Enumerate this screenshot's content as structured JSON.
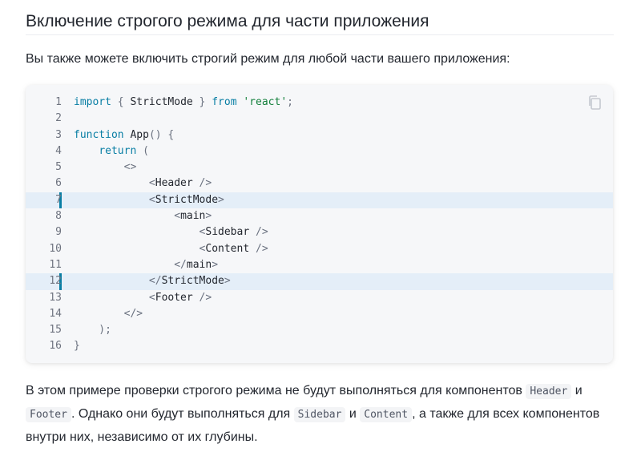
{
  "heading": "Включение строгого режима для части приложения",
  "intro": "Вы также можете включить строгий режим для любой части вашего приложения:",
  "code": {
    "copy_icon": "copy-icon",
    "highlight_color": "#e4eef8",
    "accent_color": "#087ea4",
    "lines": [
      {
        "n": "1",
        "tokens": [
          [
            "kw",
            "import"
          ],
          [
            "pn",
            " { "
          ],
          [
            "pl",
            "StrictMode"
          ],
          [
            "pn",
            " } "
          ],
          [
            "kw",
            "from"
          ],
          [
            "pn",
            " "
          ],
          [
            "str",
            "'react'"
          ],
          [
            "pn",
            ";"
          ]
        ]
      },
      {
        "n": "2",
        "tokens": []
      },
      {
        "n": "3",
        "tokens": [
          [
            "kw",
            "function"
          ],
          [
            "pn",
            " "
          ],
          [
            "pl",
            "App"
          ],
          [
            "pn",
            "() {"
          ]
        ]
      },
      {
        "n": "4",
        "tokens": [
          [
            "pn",
            "    "
          ],
          [
            "kw",
            "return"
          ],
          [
            "pn",
            " ("
          ]
        ]
      },
      {
        "n": "5",
        "tokens": [
          [
            "pn",
            "        <>"
          ]
        ]
      },
      {
        "n": "6",
        "tokens": [
          [
            "pn",
            "            <"
          ],
          [
            "pl",
            "Header"
          ],
          [
            "pn",
            " />"
          ]
        ]
      },
      {
        "n": "7",
        "hl": true,
        "tokens": [
          [
            "pn",
            "            <"
          ],
          [
            "pl",
            "StrictMode"
          ],
          [
            "pn",
            ">"
          ]
        ]
      },
      {
        "n": "8",
        "tokens": [
          [
            "pn",
            "                <"
          ],
          [
            "pl",
            "main"
          ],
          [
            "pn",
            ">"
          ]
        ]
      },
      {
        "n": "9",
        "tokens": [
          [
            "pn",
            "                    <"
          ],
          [
            "pl",
            "Sidebar"
          ],
          [
            "pn",
            " />"
          ]
        ]
      },
      {
        "n": "10",
        "tokens": [
          [
            "pn",
            "                    <"
          ],
          [
            "pl",
            "Content"
          ],
          [
            "pn",
            " />"
          ]
        ]
      },
      {
        "n": "11",
        "tokens": [
          [
            "pn",
            "                </"
          ],
          [
            "pl",
            "main"
          ],
          [
            "pn",
            ">"
          ]
        ]
      },
      {
        "n": "12",
        "hl": true,
        "tokens": [
          [
            "pn",
            "            </"
          ],
          [
            "pl",
            "StrictMode"
          ],
          [
            "pn",
            ">"
          ]
        ]
      },
      {
        "n": "13",
        "tokens": [
          [
            "pn",
            "            <"
          ],
          [
            "pl",
            "Footer"
          ],
          [
            "pn",
            " />"
          ]
        ]
      },
      {
        "n": "14",
        "tokens": [
          [
            "pn",
            "        </>"
          ]
        ]
      },
      {
        "n": "15",
        "tokens": [
          [
            "pn",
            "    );"
          ]
        ]
      },
      {
        "n": "16",
        "tokens": [
          [
            "pn",
            "}"
          ]
        ]
      }
    ]
  },
  "para": {
    "t1": "В этом примере проверки строгого режима не будут выполняться для компонентов ",
    "c1": "Header",
    "t2": " и ",
    "c2": "Footer",
    "t3": ". Однако они будут выполняться для ",
    "c3": "Sidebar",
    "t4": " и ",
    "c4": "Content",
    "t5": ", а также для всех компонентов внутри них, независимо от их глубины."
  }
}
